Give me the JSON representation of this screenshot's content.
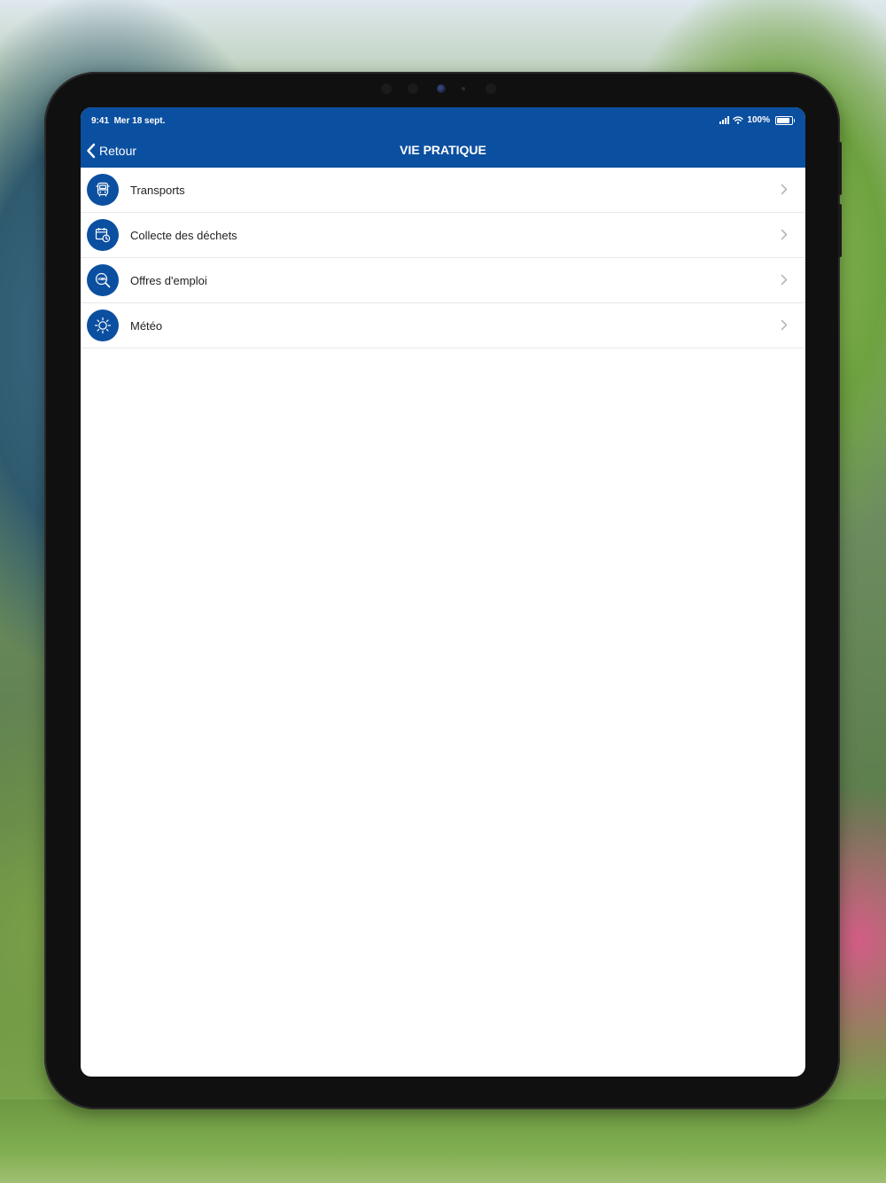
{
  "status_bar": {
    "time": "9:41",
    "date": "Mer 18 sept.",
    "battery_text": "100%",
    "battery_level": 1.0
  },
  "nav": {
    "back_label": "Retour",
    "title": "VIE PRATIQUE"
  },
  "list": {
    "items": [
      {
        "label": "Transports",
        "icon": "bus-icon"
      },
      {
        "label": "Collecte des déchets",
        "icon": "calendar-clock-icon"
      },
      {
        "label": "Offres d'emploi",
        "icon": "jobs-search-icon"
      },
      {
        "label": "Météo",
        "icon": "sun-icon"
      }
    ]
  },
  "colors": {
    "brand_blue": "#0b4fa0",
    "text": "#222222",
    "chevron": "#b8b8b8",
    "divider": "#e8e8e8"
  }
}
